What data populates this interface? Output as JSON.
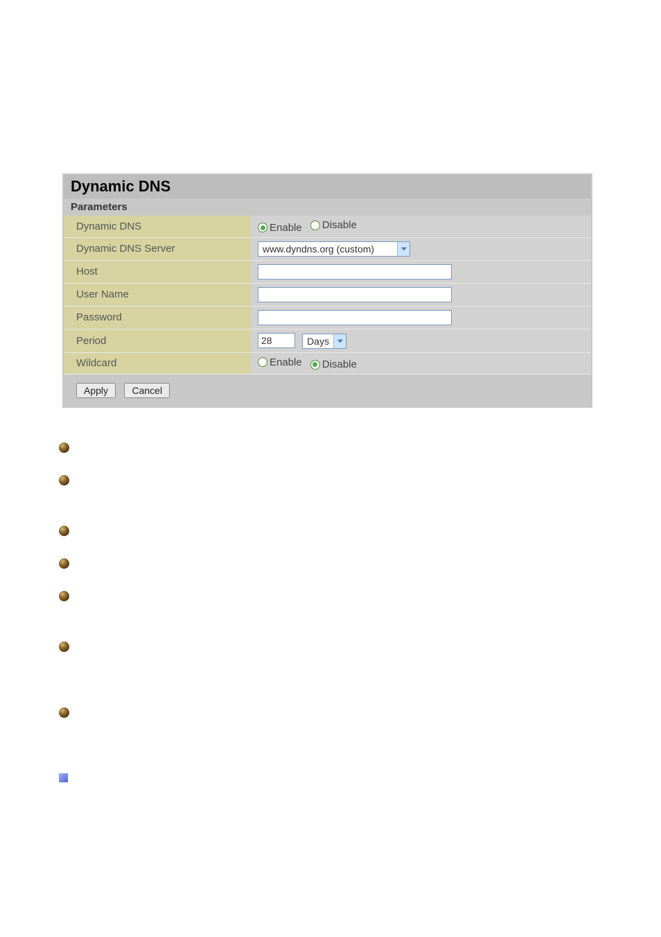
{
  "title": "Dynamic DNS",
  "subheader": "Parameters",
  "rows": {
    "dyndns": {
      "label": "Dynamic DNS",
      "enable": "Enable",
      "disable": "Disable",
      "selected": "enable"
    },
    "server": {
      "label": "Dynamic DNS Server",
      "selected": "www.dyndns.org (custom)"
    },
    "host": {
      "label": "Host",
      "value": ""
    },
    "username": {
      "label": "User Name",
      "value": ""
    },
    "password": {
      "label": "Password",
      "value": ""
    },
    "period": {
      "label": "Period",
      "value": "28",
      "unit": "Days"
    },
    "wildcard": {
      "label": "Wildcard",
      "enable": "Enable",
      "disable": "Disable",
      "selected": "disable"
    }
  },
  "buttons": {
    "apply": "Apply",
    "cancel": "Cancel"
  }
}
